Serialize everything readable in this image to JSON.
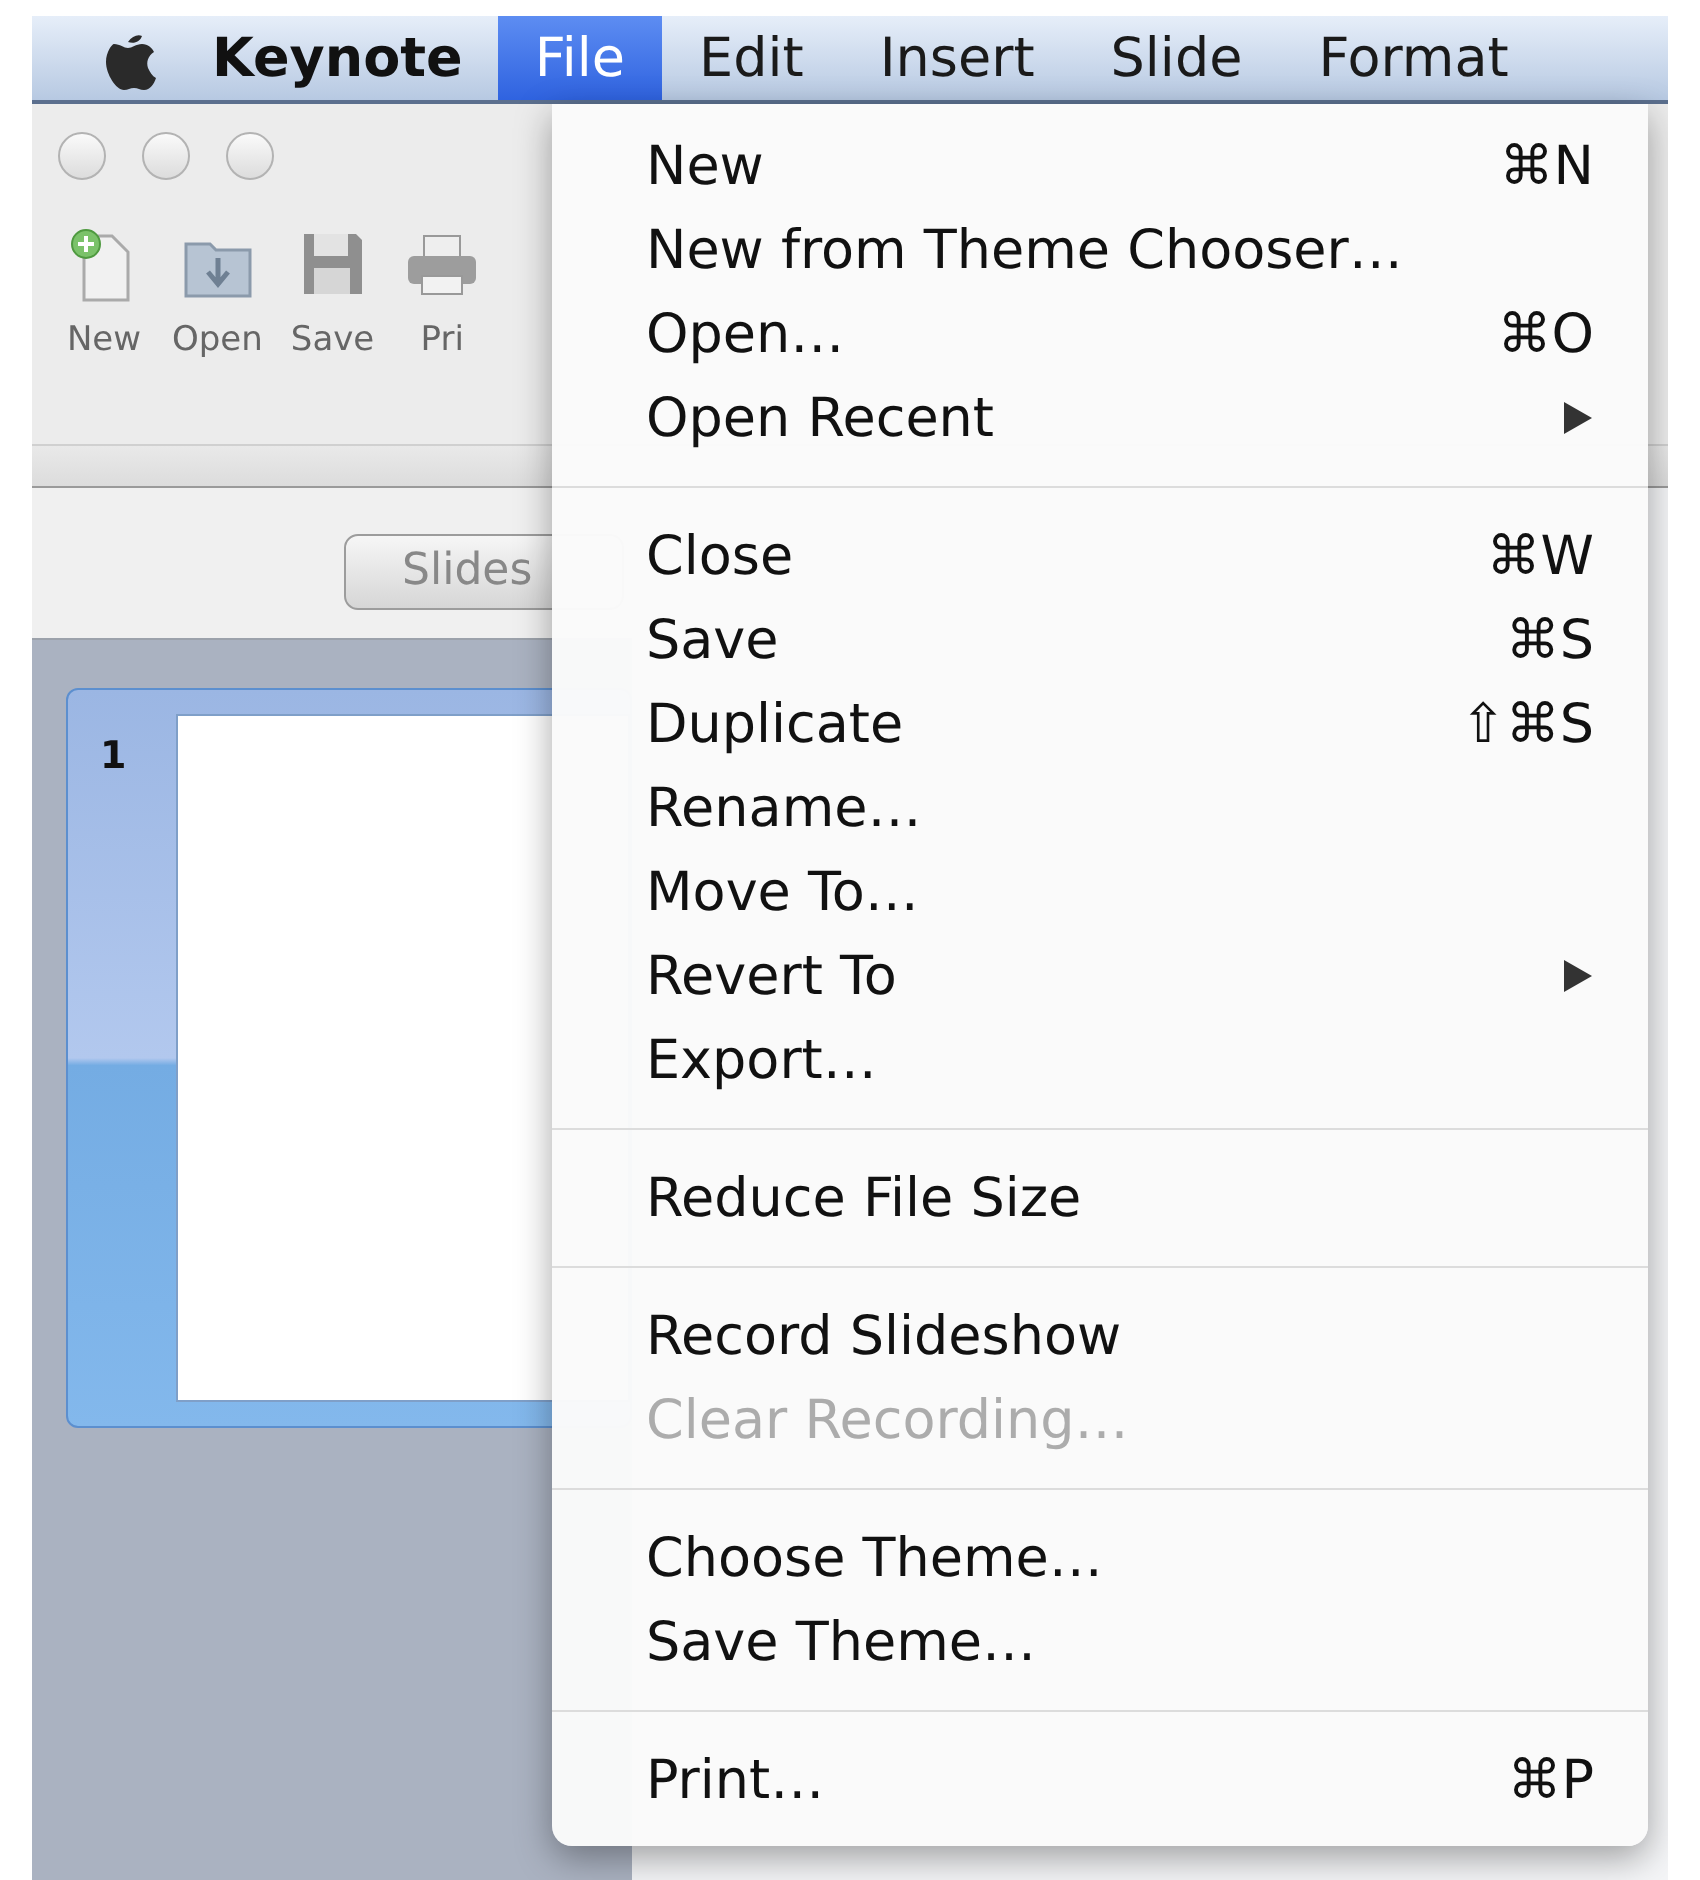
{
  "menubar": {
    "app_name": "Keynote",
    "menus": [
      {
        "label": "File",
        "selected": true
      },
      {
        "label": "Edit",
        "selected": false
      },
      {
        "label": "Insert",
        "selected": false
      },
      {
        "label": "Slide",
        "selected": false
      },
      {
        "label": "Format",
        "selected": false
      }
    ]
  },
  "toolbar": {
    "items": [
      {
        "label": "New"
      },
      {
        "label": "Open"
      },
      {
        "label": "Save"
      },
      {
        "label": "Pri"
      }
    ]
  },
  "slides_panel": {
    "button": "Slides",
    "slides": [
      {
        "number": "1",
        "selected": true
      }
    ]
  },
  "file_menu": {
    "items": [
      {
        "kind": "item",
        "label": "New",
        "shortcut": "⌘N",
        "submenu": false,
        "disabled": false
      },
      {
        "kind": "item",
        "label": "New from Theme Chooser…",
        "submenu": false,
        "disabled": false
      },
      {
        "kind": "item",
        "label": "Open…",
        "shortcut": "⌘O",
        "submenu": false,
        "disabled": false
      },
      {
        "kind": "item",
        "label": "Open Recent",
        "submenu": true,
        "disabled": false
      },
      {
        "kind": "separator"
      },
      {
        "kind": "item",
        "label": "Close",
        "shortcut": "⌘W",
        "submenu": false,
        "disabled": false
      },
      {
        "kind": "item",
        "label": "Save",
        "shortcut": "⌘S",
        "submenu": false,
        "disabled": false
      },
      {
        "kind": "item",
        "label": "Duplicate",
        "shortcut": "⇧⌘S",
        "submenu": false,
        "disabled": false
      },
      {
        "kind": "item",
        "label": "Rename…",
        "submenu": false,
        "disabled": false
      },
      {
        "kind": "item",
        "label": "Move To…",
        "submenu": false,
        "disabled": false
      },
      {
        "kind": "item",
        "label": "Revert To",
        "submenu": true,
        "disabled": false
      },
      {
        "kind": "item",
        "label": "Export…",
        "submenu": false,
        "disabled": false
      },
      {
        "kind": "separator"
      },
      {
        "kind": "item",
        "label": "Reduce File Size",
        "submenu": false,
        "disabled": false
      },
      {
        "kind": "separator"
      },
      {
        "kind": "item",
        "label": "Record Slideshow",
        "submenu": false,
        "disabled": false
      },
      {
        "kind": "item",
        "label": "Clear Recording…",
        "submenu": false,
        "disabled": true
      },
      {
        "kind": "separator"
      },
      {
        "kind": "item",
        "label": "Choose Theme…",
        "submenu": false,
        "disabled": false
      },
      {
        "kind": "item",
        "label": "Save Theme…",
        "submenu": false,
        "disabled": false
      },
      {
        "kind": "separator"
      },
      {
        "kind": "item",
        "label": "Print…",
        "shortcut": "⌘P",
        "submenu": false,
        "disabled": false
      }
    ]
  }
}
